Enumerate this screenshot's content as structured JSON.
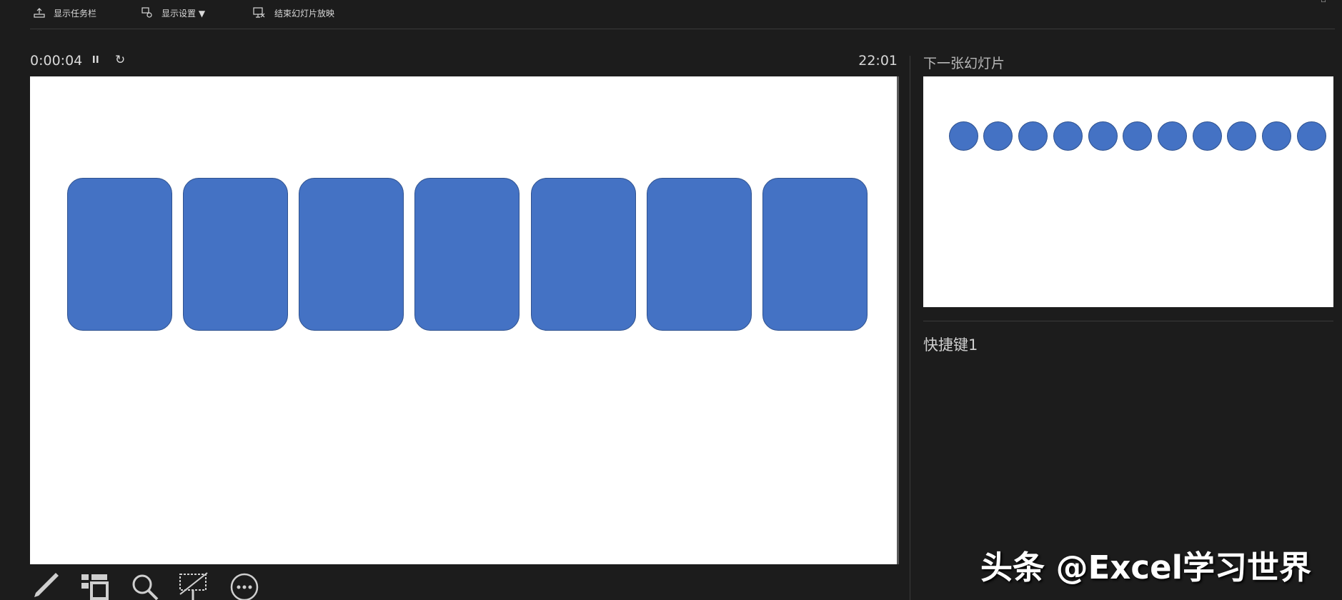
{
  "toolbar": {
    "show_taskbar": "显示任务栏",
    "display_settings": "显示设置 ▼",
    "end_slideshow": "结束幻灯片放映"
  },
  "timer": {
    "elapsed": "0:00:04",
    "pause_icon": "pause-icon",
    "reset_icon": "reset-icon",
    "clock": "22:01"
  },
  "current_slide": {
    "shapes": "7 blue rounded rectangles",
    "shape_color": "#4472c4",
    "card_count": 7
  },
  "next_slide": {
    "label": "下一张幻灯片",
    "circle_count": 11,
    "shape_color": "#4472c4"
  },
  "notes": {
    "text": "快捷键1"
  },
  "bottom_tools": [
    "pen-icon",
    "see-all-slides-icon",
    "zoom-icon",
    "black-screen-icon",
    "more-options-icon"
  ],
  "watermark": {
    "text": "头条 @Excel学习世界"
  },
  "colors": {
    "background": "#1c1c1c",
    "accent": "#4472c4",
    "slide": "#ffffff"
  }
}
